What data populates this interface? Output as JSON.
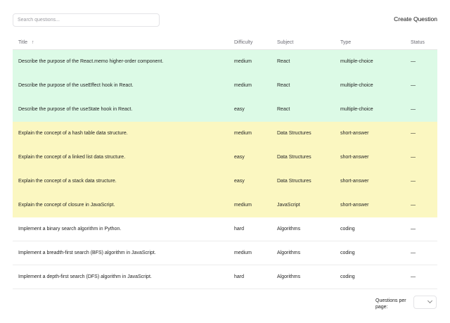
{
  "search": {
    "placeholder": "Search questions...",
    "value": ""
  },
  "toolbar": {
    "create_label": "Create Question"
  },
  "table": {
    "headers": {
      "title": "Title",
      "difficulty": "Difficulty",
      "subject": "Subject",
      "type": "Type",
      "status": "Status"
    },
    "sort_icon": "arrow-up-icon",
    "rows": [
      {
        "title": "Describe the purpose of the React.memo higher-order component.",
        "difficulty": "medium",
        "subject": "React",
        "type": "multiple-choice",
        "status": "—",
        "highlight": "#dcfae6"
      },
      {
        "title": "Describe the purpose of the useEffect hook in React.",
        "difficulty": "medium",
        "subject": "React",
        "type": "multiple-choice",
        "status": "—",
        "highlight": "#dcfae6"
      },
      {
        "title": "Describe the purpose of the useState hook in React.",
        "difficulty": "easy",
        "subject": "React",
        "type": "multiple-choice",
        "status": "—",
        "highlight": "#dcfae6"
      },
      {
        "title": "Explain the concept of a hash table data structure.",
        "difficulty": "medium",
        "subject": "Data Structures",
        "type": "short-answer",
        "status": "—",
        "highlight": "#fbf7c1"
      },
      {
        "title": "Explain the concept of a linked list data structure.",
        "difficulty": "easy",
        "subject": "Data Structures",
        "type": "short-answer",
        "status": "—",
        "highlight": "#fbf7c1"
      },
      {
        "title": "Explain the concept of a stack data structure.",
        "difficulty": "easy",
        "subject": "Data Structures",
        "type": "short-answer",
        "status": "—",
        "highlight": "#fbf7c1"
      },
      {
        "title": "Explain the concept of closure in JavaScript.",
        "difficulty": "medium",
        "subject": "JavaScript",
        "type": "short-answer",
        "status": "—",
        "highlight": "#fbf7c1"
      },
      {
        "title": "Implement a binary search algorithm in Python.",
        "difficulty": "hard",
        "subject": "Algorithms",
        "type": "coding",
        "status": "—",
        "highlight": "#ffffff"
      },
      {
        "title": "Implement a breadth-first search (BFS) algorithm in JavaScript.",
        "difficulty": "medium",
        "subject": "Algorithms",
        "type": "coding",
        "status": "—",
        "highlight": "#ffffff"
      },
      {
        "title": "Implement a depth-first search (DFS) algorithm in JavaScript.",
        "difficulty": "hard",
        "subject": "Algorithms",
        "type": "coding",
        "status": "—",
        "highlight": "#ffffff"
      }
    ]
  },
  "pagination": {
    "per_page_label": "Questions per page:",
    "per_page_value": "",
    "select_icon": "chevron-down-icon"
  }
}
